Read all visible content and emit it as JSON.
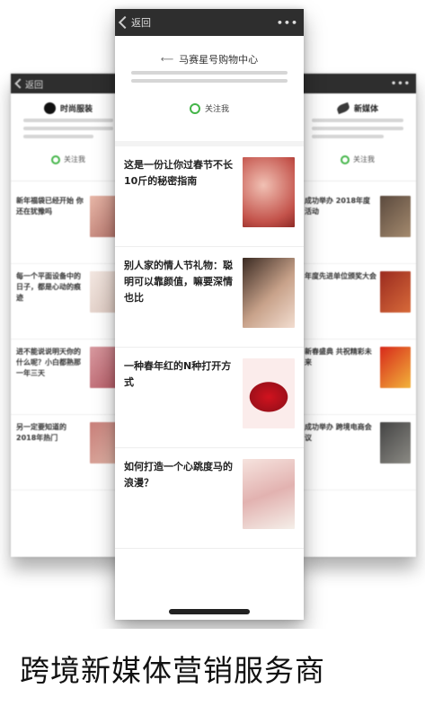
{
  "colors": {
    "topbar": "#2e2e2e",
    "wechat_green": "#44b549",
    "page_bg": "#ffffff"
  },
  "center_phone": {
    "nav": {
      "back_label": "返回",
      "more_label": "•••"
    },
    "account": {
      "name": "马赛星号购物中心",
      "arrow_icon": "arrow-left-icon"
    },
    "follow_label": "关注我",
    "articles": [
      {
        "title": "这是一份让你过春节不长10斤的秘密指南",
        "thumb_icon": "massage-photo"
      },
      {
        "title": "别人家的情人节礼物：聪明可以靠颜值，嘛要深情也比",
        "thumb_icon": "couple-photo"
      },
      {
        "title": "一种春年红的N种打开方式",
        "thumb_icon": "red-lips-photo"
      },
      {
        "title": "如何打造一个心跳度马的浪漫？",
        "thumb_icon": "flowers-photo"
      }
    ]
  },
  "left_phone": {
    "nav": {
      "back_label": "返回"
    },
    "account": {
      "name": "时尚服装"
    },
    "follow_label": "关注我",
    "articles": [
      {
        "title": "新年福袋已经开始 你还在犹豫吗"
      },
      {
        "title": "每一个平面设备中的日子，都是心动的痕迹"
      },
      {
        "title": "进不能说说明天你的什么呢？小白都熟那一年三天"
      },
      {
        "title": "另一定要知道的2018年热门"
      }
    ]
  },
  "right_phone": {
    "nav": {
      "more_label": "•••"
    },
    "account": {
      "name": "新媒体"
    },
    "follow_label": "关注我",
    "articles": [
      {
        "title": "成功举办 2018年度活动"
      },
      {
        "title": "年度先进单位颁奖大会"
      },
      {
        "title": "新春盛典 共祝精彩未来"
      },
      {
        "title": "成功举办 跨境电商会议"
      }
    ]
  },
  "caption": "跨境新媒体营销服务商"
}
